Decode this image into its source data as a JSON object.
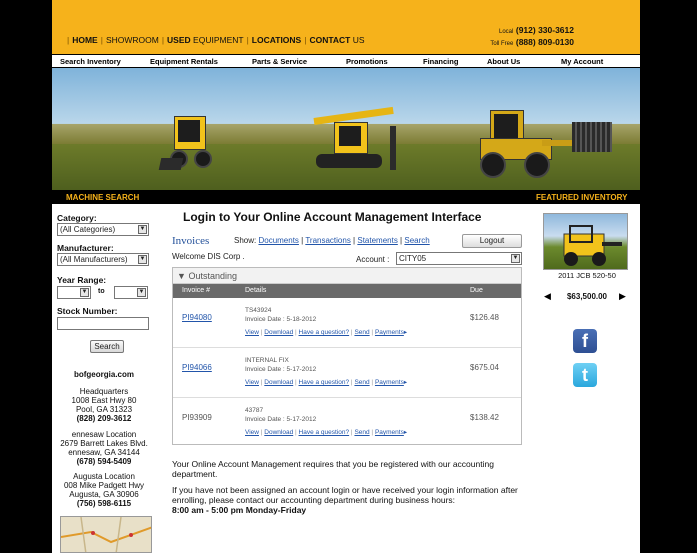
{
  "header": {
    "nav": [
      "HOME",
      "SHOWROOM",
      "USED",
      "EQUIPMENT",
      "LOCATIONS",
      "CONTACT",
      "US"
    ],
    "phone_local_label": "Local",
    "phone_local": "(912) 330-3612",
    "phone_tollfree_label": "Toll Free",
    "phone_tollfree": "(888) 809-0130"
  },
  "mainnav": {
    "items": [
      "Search Inventory",
      "Equipment Rentals",
      "Parts & Service",
      "Promotions",
      "Financing",
      "About Us",
      "My Account"
    ]
  },
  "banner": {
    "left_label": "MACHINE SEARCH",
    "right_label": "FEATURED INVENTORY"
  },
  "search": {
    "category_label": "Category:",
    "category_value": "(All Categories)",
    "manufacturer_label": "Manufacturer:",
    "manufacturer_value": "(All Manufacturers)",
    "year_label": "Year Range:",
    "year_to": "to",
    "stock_label": "Stock Number:",
    "stock_value": "",
    "search_button": "Search"
  },
  "locations": {
    "site": "bofgeorgia.com",
    "hq": [
      "Headquarters",
      "1008 East Hwy 80",
      "Pool, GA 31323",
      "(828) 209-3612"
    ],
    "kennesaw": [
      "ennesaw Location",
      "2679 Barrett Lakes Blvd.",
      "ennesaw, GA 34144",
      "(678) 594-5409"
    ],
    "augusta": [
      "Augusta Location",
      "008 Mike Padgett Hwy",
      "Augusta, GA 30906",
      "(756) 598-6115"
    ]
  },
  "content": {
    "title": "Login to Your Online Account Management Interface",
    "invoices_label": "Invoices",
    "show_label": "Show:",
    "show_links": [
      "Documents",
      "Transactions",
      "Statements",
      "Search"
    ],
    "logout_label": "Logout",
    "welcome": "Welcome DIS Corp .",
    "account_label": "Account :",
    "account_value": "CITY05",
    "outstanding_label": "Outstanding",
    "columns": [
      "Invoice #",
      "Details",
      "Due"
    ],
    "invoices": [
      {
        "num": "PI94080",
        "detail": "TS43924",
        "date": "Invoice Date : 5-18-2012",
        "due": "$126.48",
        "linked": true
      },
      {
        "num": "PI94066",
        "detail": "INTERNAL FIX",
        "date": "Invoice Date : 5-17-2012",
        "due": "$675.04",
        "linked": true
      },
      {
        "num": "PI93909",
        "detail": "43787",
        "date": "Invoice Date : 5-17-2012",
        "due": "$138.42",
        "linked": false
      }
    ],
    "row_links": [
      "View",
      "Download",
      "Have a question?",
      "Send",
      "Payments"
    ],
    "info_1": "Your Online Account Management requires that you be registered with our accounting department.",
    "info_2": "If you have not been assigned an account login or have received your login information after enrolling, please contact our accounting department during business hours:",
    "hours": "8:00 am - 5:00 pm Monday-Friday"
  },
  "featured": {
    "name": "2011 JCB 520-50",
    "price": "$63,500.00"
  },
  "colors": {
    "brand_yellow": "#f6b21b",
    "link_blue": "#2255aa"
  }
}
